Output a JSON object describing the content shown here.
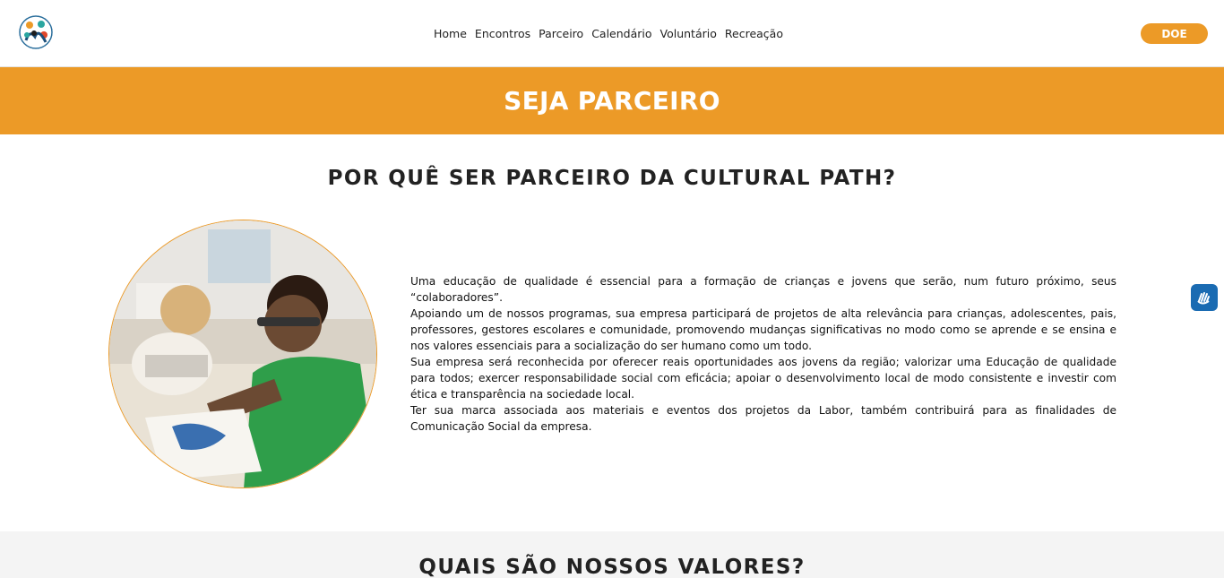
{
  "header": {
    "nav": [
      "Home",
      "Encontros",
      "Parceiro",
      "Calendário",
      "Voluntário",
      "Recreação"
    ],
    "donate_label": "DOE"
  },
  "banner": {
    "title": "SEJA PARCEIRO"
  },
  "why": {
    "title": "POR QUÊ SER PARCEIRO DA CULTURAL PATH?",
    "paragraphs": [
      "Uma educação de qualidade é essencial para a formação de crianças e jovens que serão, num futuro próximo, seus “colaboradores”.",
      "Apoiando um de nossos programas, sua empresa participará de projetos de alta relevância para crianças, adolescentes, pais, professores, gestores escolares e comunidade, promovendo mudanças significativas no modo como se aprende e se ensina e nos valores essenciais para a socialização do ser humano como um todo.",
      "Sua empresa será reconhecida por oferecer reais oportunidades aos jovens da região; valorizar uma Educação de qualidade para todos; exercer responsabilidade social com eficácia; apoiar o desenvolvimento local de modo consistente e investir com ética e transparência na sociedade local.",
      "Ter sua marca associada aos materiais e eventos dos projetos da Labor, também contribuirá para as finalidades de Comunicação Social da empresa."
    ]
  },
  "values": {
    "title": "QUAIS SÃO NOSSOS VALORES?"
  },
  "colors": {
    "accent": "#ec9a27",
    "a11y_blue": "#1a6bb2"
  },
  "icons": {
    "logo": "cultural-path-logo",
    "a11y": "sign-language-icon"
  }
}
